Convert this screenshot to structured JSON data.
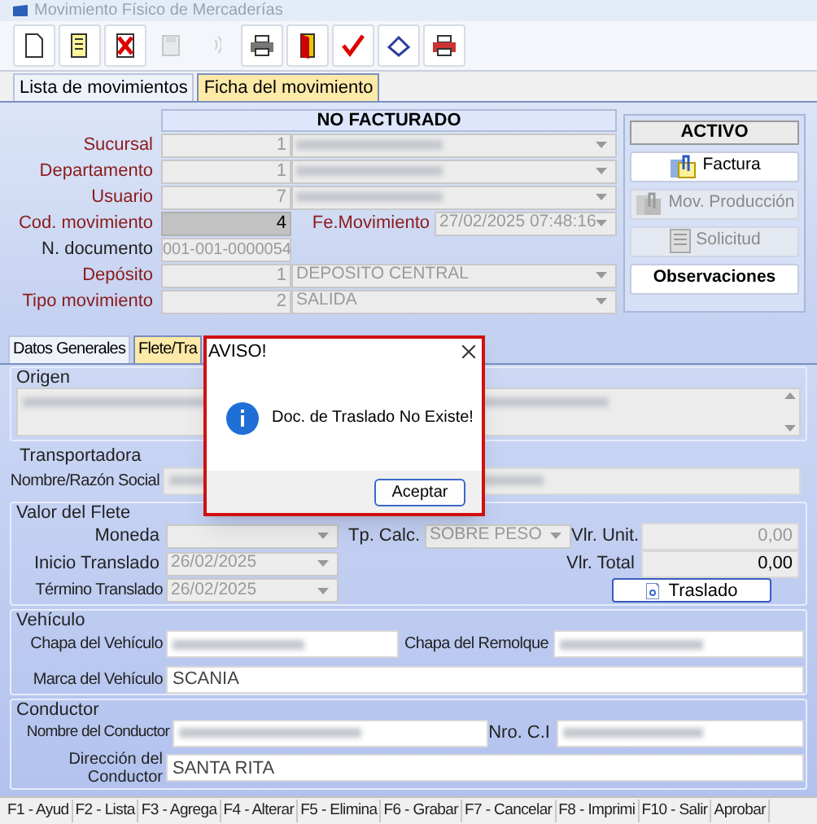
{
  "window": {
    "title": "Movimiento Físico de Mercaderías"
  },
  "toolbar": [
    {
      "kind": "new",
      "disabled": false
    },
    {
      "kind": "edit",
      "disabled": false
    },
    {
      "kind": "delete",
      "disabled": false
    },
    {
      "kind": "save",
      "disabled": true
    },
    {
      "kind": "signal",
      "disabled": true
    },
    {
      "kind": "print",
      "disabled": false
    },
    {
      "kind": "exit",
      "disabled": false
    },
    {
      "kind": "approve",
      "disabled": false
    },
    {
      "kind": "erase",
      "disabled": false
    },
    {
      "kind": "print_red",
      "disabled": false
    }
  ],
  "tabs": [
    {
      "label": "Lista de movimientos",
      "selected": false
    },
    {
      "label": "Ficha del movimiento",
      "selected": true
    }
  ],
  "header": {
    "status": "NO FACTURADO",
    "fields": [
      {
        "kind": "combo",
        "label": "Sucursal",
        "required": true,
        "code": "1",
        "blurred": true
      },
      {
        "kind": "combo",
        "label": "Departamento",
        "required": true,
        "code": "1",
        "blurred": true
      },
      {
        "kind": "combo",
        "label": "Usuario",
        "required": true,
        "code": "7",
        "blurred": true
      },
      {
        "kind": "code_date",
        "label": "Cod. movimiento",
        "required": true,
        "code": "4",
        "date_label": "Fe.Movimiento",
        "date": "27/02/2025 07:48:16"
      },
      {
        "kind": "text",
        "label": "N. documento",
        "required": false,
        "value": "001-001-0000054"
      },
      {
        "kind": "combo",
        "label": "Depósito",
        "required": true,
        "code": "1",
        "value": "DEPOSITO CENTRAL"
      },
      {
        "kind": "combo",
        "label": "Tipo movimiento",
        "required": true,
        "code": "2",
        "value": "SALIDA"
      }
    ]
  },
  "side": {
    "status": "ACTIVO",
    "buttons": [
      {
        "kind": "clip",
        "label": "Factura",
        "disabled": false
      },
      {
        "kind": "clips",
        "label": "Mov. Producción",
        "disabled": true
      },
      {
        "kind": "doc",
        "label": "Solicitud",
        "disabled": true
      },
      {
        "kind": "bold",
        "label": "Observaciones",
        "disabled": false
      }
    ]
  },
  "subtabs": [
    {
      "label": "Datos Generales",
      "selected": false
    },
    {
      "label": "Flete/Tra",
      "selected": true
    }
  ],
  "origen": {
    "title": "Origen",
    "blurred": true
  },
  "transportadora": {
    "title": "Transportadora",
    "label": "Nombre/Razón Social",
    "blurred": true
  },
  "flete": {
    "title": "Valor del Flete",
    "moneda": "Moneda",
    "tp_calc": "Tp. Calc.",
    "tp_calc_value": "SOBRE PESO",
    "vlr_unit": "Vlr. Unit.",
    "vlr_unit_value": "0,00",
    "inicio": "Inicio Translado",
    "inicio_value": "26/02/2025",
    "vlr_total": "Vlr. Total",
    "vlr_total_value": "0,00",
    "termino": "Término Translado",
    "termino_value": "26/02/2025",
    "button": "Traslado"
  },
  "vehiculo": {
    "title": "Vehículo",
    "chapa": "Chapa del Vehículo",
    "chapa_blurred": true,
    "remolque": "Chapa del Remolque",
    "remolque_blurred": true,
    "marca": "Marca del Vehículo",
    "marca_value": "SCANIA"
  },
  "conductor": {
    "title": "Conductor",
    "nombre": "Nombre del Conductor",
    "nombre_blurred": true,
    "ci": "Nro. C.I",
    "ci_blurred": true,
    "direccion": "Dirección del Conductor",
    "direccion_value": "SANTA RITA"
  },
  "dialog": {
    "title": "AVISO!",
    "message": "Doc. de Traslado No Existe!",
    "button": "Aceptar"
  },
  "status_bar": [
    "F1 - Ayud",
    "F2 - Lista",
    "F3 - Agrega",
    "F4 - Alterar",
    "F5 - Elimina",
    "F6 - Grabar",
    "F7 - Cancelar",
    "F8 - Imprimi",
    "F10 - Salir",
    "Aprobar"
  ]
}
